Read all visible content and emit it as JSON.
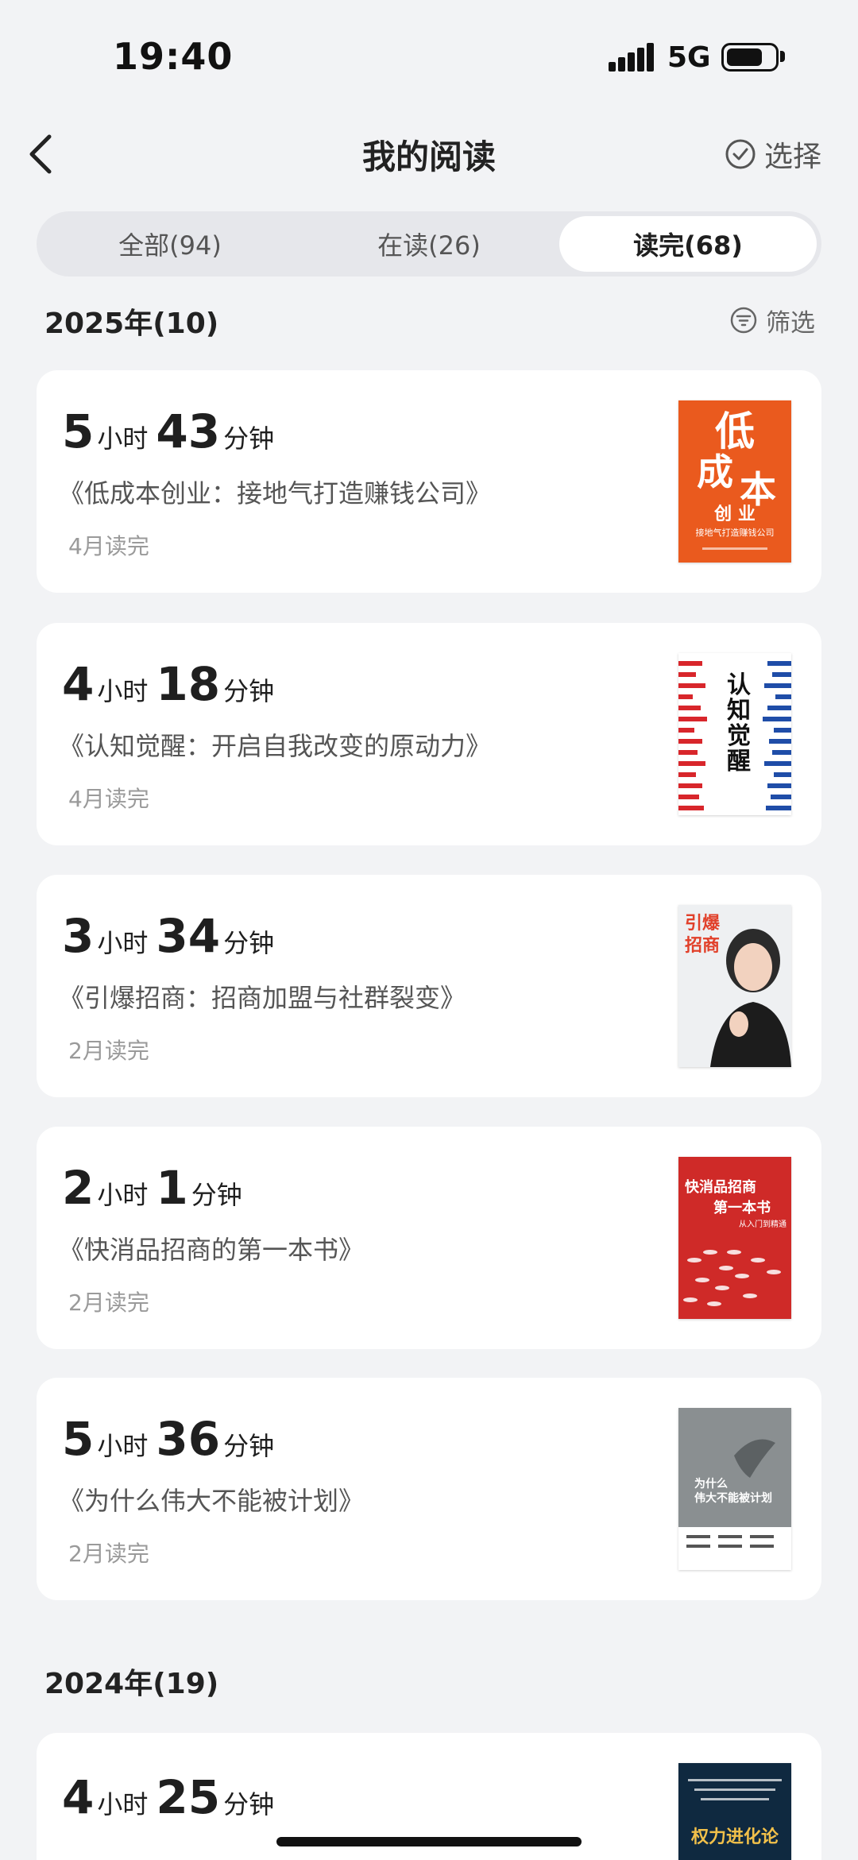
{
  "status_bar": {
    "time": "19:40",
    "network": "5G"
  },
  "nav": {
    "title": "我的阅读",
    "select_label": "选择"
  },
  "tabs": [
    {
      "label": "全部(94)",
      "active": false
    },
    {
      "label": "在读(26)",
      "active": false
    },
    {
      "label": "读完(68)",
      "active": true
    }
  ],
  "sections": [
    {
      "header": "2025年(10)",
      "filter_label": "筛选",
      "books": [
        {
          "hours": "5",
          "minutes": "43",
          "title": "《低成本创业：接地气打造赚钱公司》",
          "finished": "4月读完",
          "cover_text": "低成本",
          "cover_sub": "创业",
          "cover_small": "接地气打造赚钱公司"
        },
        {
          "hours": "4",
          "minutes": "18",
          "title": "《认知觉醒：开启自我改变的原动力》",
          "finished": "4月读完",
          "cover_text": "认知觉醒"
        },
        {
          "hours": "3",
          "minutes": "34",
          "title": "《引爆招商：招商加盟与社群裂变》",
          "finished": "2月读完",
          "cover_text": "引爆招商"
        },
        {
          "hours": "2",
          "minutes": "1",
          "title": "《快消品招商的第一本书》",
          "finished": "2月读完",
          "cover_text": "快消品招商的第一本书",
          "cover_small": "从入门到精通"
        },
        {
          "hours": "5",
          "minutes": "36",
          "title": "《为什么伟大不能被计划》",
          "finished": "2月读完",
          "cover_text": "为什么伟大不能被计划"
        }
      ]
    },
    {
      "header": "2024年(19)",
      "books": [
        {
          "hours": "4",
          "minutes": "25",
          "cover_text": "权力进化论"
        }
      ]
    }
  ],
  "labels": {
    "hour_unit": "小时",
    "minute_unit": "分钟"
  },
  "colors": {
    "background": "#f2f3f5",
    "card": "#ffffff",
    "tab_track": "#e6e7eb"
  }
}
